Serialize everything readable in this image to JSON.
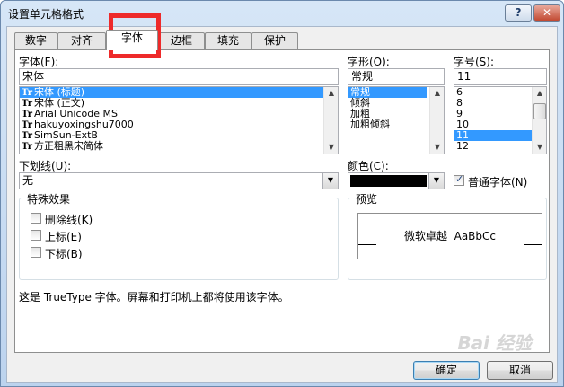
{
  "window": {
    "title": "设置单元格格式",
    "help_label": "?",
    "close_label": "✕"
  },
  "tabs": [
    {
      "label": "数字",
      "active": false
    },
    {
      "label": "对齐",
      "active": false
    },
    {
      "label": "字体",
      "active": true
    },
    {
      "label": "边框",
      "active": false
    },
    {
      "label": "填充",
      "active": false
    },
    {
      "label": "保护",
      "active": false
    }
  ],
  "font": {
    "label": "字体(F):",
    "value": "宋体",
    "items": [
      "宋体 (标题)",
      "宋体 (正文)",
      "Arial Unicode MS",
      "hakuyoxingshu7000",
      "SimSun-ExtB",
      "方正粗黑宋简体"
    ],
    "selected_index": 0,
    "item_icon": "Tr"
  },
  "style": {
    "label": "字形(O):",
    "value": "常规",
    "items": [
      "常规",
      "倾斜",
      "加粗",
      "加粗倾斜"
    ],
    "selected_index": 0
  },
  "size": {
    "label": "字号(S):",
    "value": "11",
    "items": [
      "6",
      "8",
      "9",
      "10",
      "11",
      "12"
    ],
    "selected_index": 4
  },
  "underline": {
    "label": "下划线(U):",
    "value": "无"
  },
  "color": {
    "label": "颜色(C):",
    "swatch": "#000000"
  },
  "normal_font": {
    "label": "普通字体(N)",
    "checked": true
  },
  "effects": {
    "title": "特殊效果",
    "items": [
      {
        "label": "删除线(K)",
        "checked": false
      },
      {
        "label": "上标(E)",
        "checked": false
      },
      {
        "label": "下标(B)",
        "checked": false
      }
    ]
  },
  "preview": {
    "title": "预览",
    "text": "微软卓越  AaBbCc"
  },
  "description": "这是 TrueType 字体。屏幕和打印机上都将使用该字体。",
  "buttons": {
    "ok": "确定",
    "cancel": "取消"
  },
  "watermark": "Bai 经验",
  "colors": {
    "selection": "#3399ff",
    "highlight": "#ee2a2a"
  }
}
